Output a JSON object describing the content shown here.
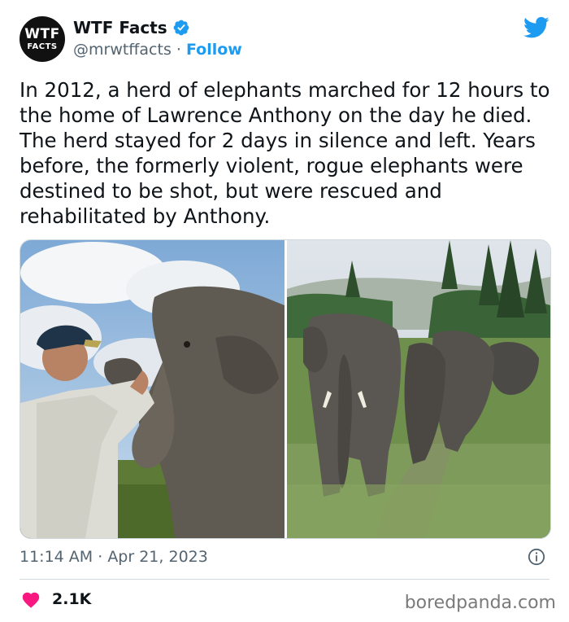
{
  "account": {
    "avatar_line1": "WTF",
    "avatar_line2": "FACTS",
    "name": "WTF Facts",
    "handle": "@mrwtffacts",
    "separator": " · ",
    "follow_label": "Follow"
  },
  "tweet": {
    "text": "In 2012, a herd of elephants marched for 12 hours to the home of Lawrence Anthony on the day he died. The herd stayed for 2 days in silence and left. Years before, the formerly violent, rogue elephants were destined to be shot, but were rescued and rehabilitated by Anthony.",
    "time": "11:14 AM",
    "date": "Apr 21, 2023",
    "likes": "2.1K"
  },
  "watermark": "boredpanda.com",
  "icons": {
    "brand": "twitter-bird-icon",
    "verified": "verified-badge-icon",
    "info": "info-icon",
    "like": "heart-icon"
  },
  "colors": {
    "accent": "#1d9bf0",
    "like": "#f91880",
    "text": "#0f1419",
    "muted": "#536471"
  }
}
